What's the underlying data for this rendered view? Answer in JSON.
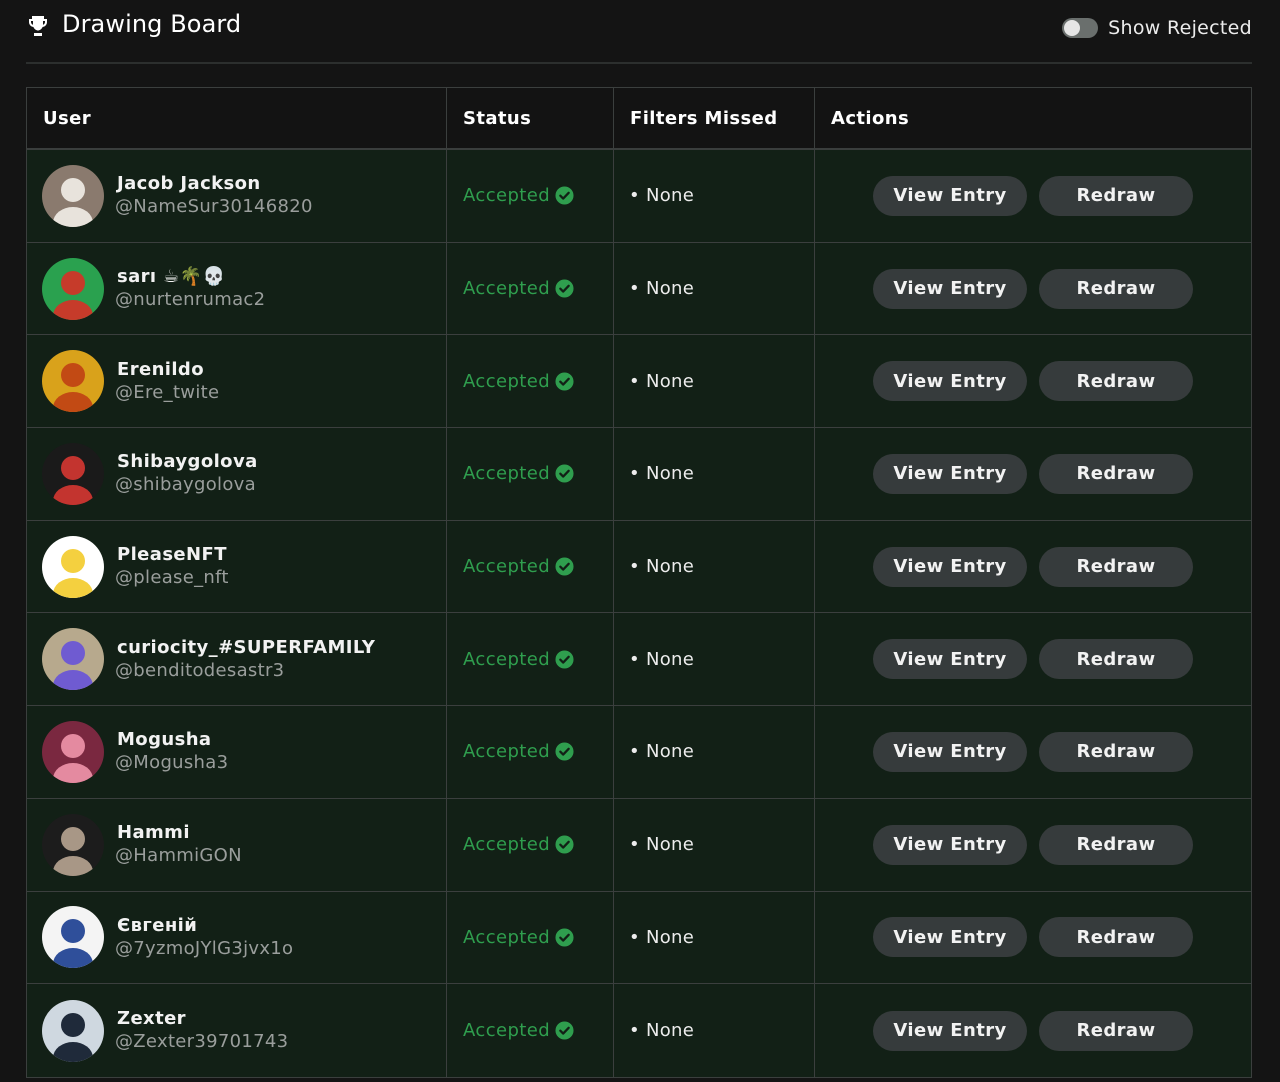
{
  "header": {
    "title": "Drawing Board",
    "toggle_label": "Show Rejected",
    "toggle_on": false
  },
  "table": {
    "columns": [
      "User",
      "Status",
      "Filters Missed",
      "Actions"
    ],
    "rows": [
      {
        "name": "Jacob Jackson",
        "handle": "@NameSur30146820",
        "status": "Accepted",
        "filters": "• None",
        "avatar_colors": [
          "#8a7a6e",
          "#e8e3dc"
        ]
      },
      {
        "name": "sarı ☕🌴💀",
        "handle": "@nurtenrumac2",
        "status": "Accepted",
        "filters": "• None",
        "avatar_colors": [
          "#2aa14f",
          "#c63b2a"
        ]
      },
      {
        "name": "Erenildo",
        "handle": "@Ere_twite",
        "status": "Accepted",
        "filters": "• None",
        "avatar_colors": [
          "#d9a21b",
          "#c24a14"
        ]
      },
      {
        "name": "Shibaygolova",
        "handle": "@shibaygolova",
        "status": "Accepted",
        "filters": "• None",
        "avatar_colors": [
          "#1a1a1a",
          "#c3342f"
        ]
      },
      {
        "name": "PleaseNFT",
        "handle": "@please_nft",
        "status": "Accepted",
        "filters": "• None",
        "avatar_colors": [
          "#ffffff",
          "#f4d03f"
        ]
      },
      {
        "name": "curiocity_#SUPERFAMILY",
        "handle": "@benditodesastr3",
        "status": "Accepted",
        "filters": "• None",
        "avatar_colors": [
          "#b7a98d",
          "#6f5bd1"
        ]
      },
      {
        "name": "Mogusha",
        "handle": "@Mogusha3",
        "status": "Accepted",
        "filters": "• None",
        "avatar_colors": [
          "#7a2840",
          "#e48aa0"
        ]
      },
      {
        "name": "Hammi",
        "handle": "@HammiGON",
        "status": "Accepted",
        "filters": "• None",
        "avatar_colors": [
          "#1c1c1c",
          "#a89786"
        ]
      },
      {
        "name": "Євгеній",
        "handle": "@7yzmoJYlG3jvx1o",
        "status": "Accepted",
        "filters": "• None",
        "avatar_colors": [
          "#f4f4f4",
          "#2f4f9a"
        ]
      },
      {
        "name": "Zexter",
        "handle": "@Zexter39701743",
        "status": "Accepted",
        "filters": "• None",
        "avatar_colors": [
          "#cfd8e0",
          "#1f2a3a"
        ]
      }
    ],
    "view_label": "View Entry",
    "redraw_label": "Redraw"
  },
  "colors": {
    "background": "#141414",
    "row_bg": "#122016",
    "accepted": "#2f9e4e",
    "button_bg": "#363b3c"
  },
  "icons": {
    "header": "trophy-icon",
    "status": "check-circle-icon"
  }
}
